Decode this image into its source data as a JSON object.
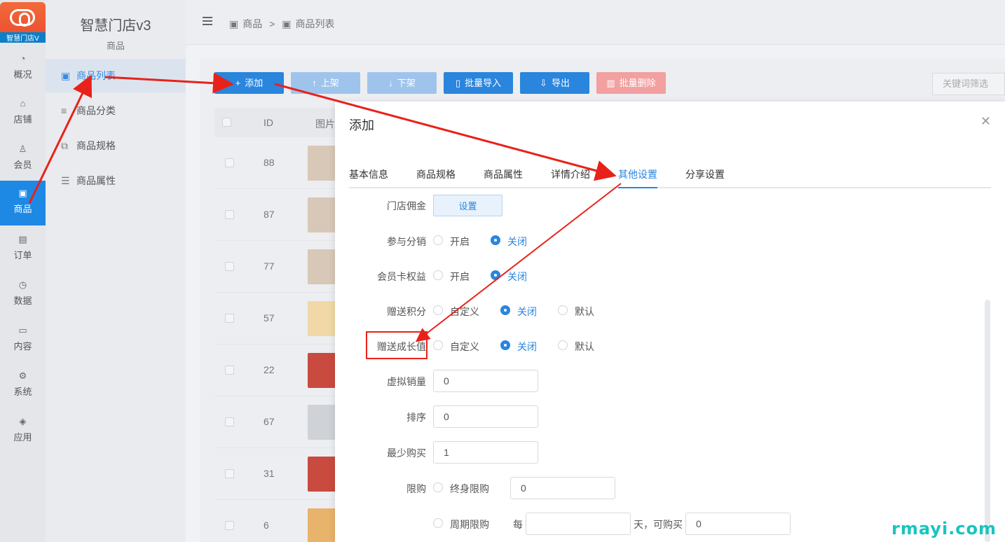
{
  "rail": {
    "logo_text": "智慧门店V",
    "items": [
      {
        "label": "概况",
        "icon": "dashboard-icon"
      },
      {
        "label": "店铺",
        "icon": "store-icon"
      },
      {
        "label": "会员",
        "icon": "user-icon"
      },
      {
        "label": "商品",
        "icon": "box-icon"
      },
      {
        "label": "订单",
        "icon": "clipboard-icon"
      },
      {
        "label": "数据",
        "icon": "pie-icon"
      },
      {
        "label": "内容",
        "icon": "folder-icon"
      },
      {
        "label": "系统",
        "icon": "gear-icon"
      },
      {
        "label": "应用",
        "icon": "cube-icon"
      }
    ]
  },
  "sidebar": {
    "title": "智慧门店v3",
    "subtitle": "商品",
    "items": [
      {
        "label": "商品列表",
        "icon": "box-icon"
      },
      {
        "label": "商品分类",
        "icon": "list-icon"
      },
      {
        "label": "商品规格",
        "icon": "copy-icon"
      },
      {
        "label": "商品属性",
        "icon": "sliders-icon"
      }
    ]
  },
  "breadcrumb": {
    "root": "商品",
    "sep": ">",
    "current": "商品列表"
  },
  "toolbar": {
    "add": "添加",
    "up": "上架",
    "down": "下架",
    "import": "批量导入",
    "export": "导出",
    "delete": "批量删除",
    "keyword_placeholder": "关键词筛选"
  },
  "table": {
    "headers": {
      "id": "ID",
      "image": "图片"
    },
    "rows": [
      {
        "id": "88",
        "thumb_color": "#d8c8b8"
      },
      {
        "id": "87",
        "thumb_color": "#d8c8b8"
      },
      {
        "id": "77",
        "thumb_color": "#d8c8b8"
      },
      {
        "id": "57",
        "thumb_color": "#f0d9a6"
      },
      {
        "id": "22",
        "thumb_color": "#c94a3e"
      },
      {
        "id": "67",
        "thumb_color": "#cfd2d6"
      },
      {
        "id": "31",
        "thumb_color": "#c94a3e"
      },
      {
        "id": "6",
        "thumb_color": "#e8b36a"
      }
    ]
  },
  "modal": {
    "title": "添加",
    "tabs": [
      "基本信息",
      "商品规格",
      "商品属性",
      "详情介绍",
      "其他设置",
      "分享设置"
    ],
    "active_tab": "其他设置",
    "fields": {
      "store_commission": {
        "label": "门店佣金",
        "button": "设置"
      },
      "distribution": {
        "label": "参与分销",
        "options": [
          "开启",
          "关闭"
        ],
        "selected": "关闭"
      },
      "member_card": {
        "label": "会员卡权益",
        "options": [
          "开启",
          "关闭"
        ],
        "selected": "关闭"
      },
      "points": {
        "label": "赠送积分",
        "options": [
          "自定义",
          "关闭",
          "默认"
        ],
        "selected": "关闭"
      },
      "growth": {
        "label": "赠送成长值",
        "options": [
          "自定义",
          "关闭",
          "默认"
        ],
        "selected": "关闭"
      },
      "virtual_sales": {
        "label": "虚拟销量",
        "value": "0"
      },
      "sort": {
        "label": "排序",
        "value": "0"
      },
      "min_buy": {
        "label": "最少购买",
        "value": "1"
      },
      "limit": {
        "label": "限购",
        "lifetime_label": "终身限购",
        "lifetime_value": "0",
        "period_label": "周期限购",
        "every": "每",
        "days_value": "",
        "days_text": "天，可购买",
        "period_value": "0"
      }
    }
  },
  "watermark": "rmayi.com",
  "colors": {
    "primary": "#2a85dd",
    "annotation": "#e8221a"
  }
}
